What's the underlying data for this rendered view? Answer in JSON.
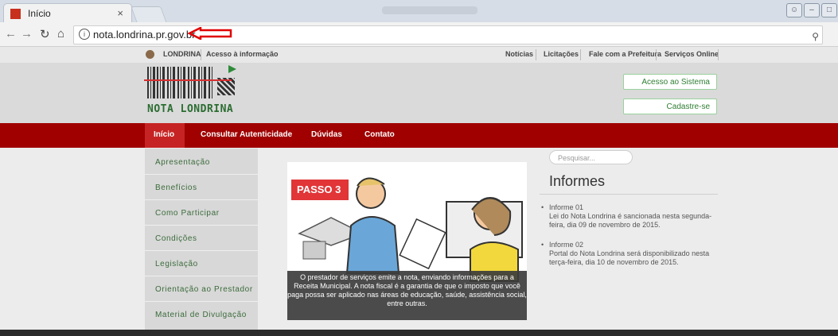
{
  "browser": {
    "tab_title": "Início",
    "tab_close": "×",
    "url": "nota.londrina.pr.gov.br",
    "zoom_icon": "magnifier-icon",
    "colors": {
      "annotation_arrow": "#e00000"
    }
  },
  "site": {
    "top_links": {
      "city": "LONDRINA",
      "access": "Acesso à informação",
      "right": [
        "Notícias",
        "Licitações",
        "Fale com a Prefeitura",
        "Serviços Online"
      ]
    },
    "logo_text": "NOTA LONDRINA",
    "buttons": {
      "access": "Acesso ao Sistema",
      "register": "Cadastre-se"
    },
    "menu": [
      "Início",
      "Consultar Autenticidade",
      "Dúvidas",
      "Contato"
    ],
    "sidebar": [
      "Apresentação",
      "Benefícios",
      "Como Participar",
      "Condições",
      "Legislação",
      "Orientação ao Prestador",
      "Material de Divulgação"
    ],
    "hero": {
      "badge": "PASSO 3",
      "caption": "O prestador de serviços emite a nota, enviando informações para a Receita Municipal. A nota fiscal é a garantia de que o imposto que você paga possa ser aplicado nas áreas de educação, saúde, assistência social, entre outras."
    },
    "search_placeholder": "Pesquisar...",
    "informes": {
      "title": "Informes",
      "items": [
        {
          "title": "Informe 01",
          "text": "Lei do Nota Londrina é sancionada nesta segunda-feira, dia 09 de novembro de 2015."
        },
        {
          "title": "Informe 02",
          "text": "Portal do Nota Londrina será disponibilizado nesta terça-feira, dia 10 de novembro de 2015."
        }
      ]
    },
    "colors": {
      "menu_bg": "#a00000",
      "menu_active": "#c62424",
      "accent_green": "#2e7d32"
    }
  }
}
